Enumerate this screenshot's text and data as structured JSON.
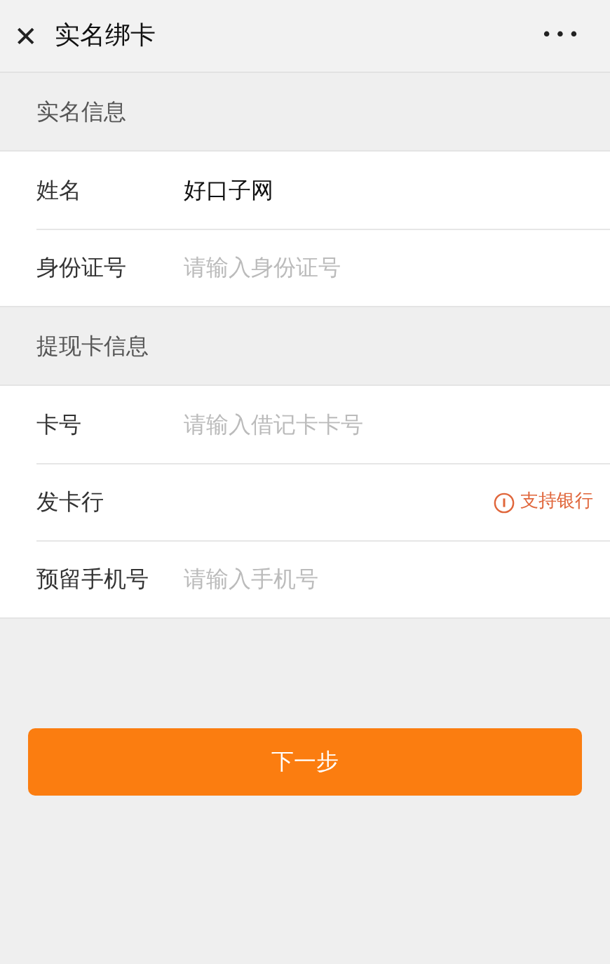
{
  "header": {
    "close": "✕",
    "title": "实名绑卡",
    "more": "•••"
  },
  "sections": [
    {
      "title": "实名信息",
      "rows": [
        {
          "kind": "input",
          "label": "姓名",
          "value": "好口子网"
        },
        {
          "kind": "input",
          "label": "身份证号",
          "placeholder": "请输入身份证号"
        }
      ]
    },
    {
      "title": "提现卡信息",
      "rows": [
        {
          "kind": "input",
          "label": "卡号",
          "placeholder": "请输入借记卡卡号"
        },
        {
          "kind": "link",
          "label": "发卡行",
          "action": "支持银行"
        },
        {
          "kind": "input",
          "label": "预留手机号",
          "placeholder": "请输入手机号"
        }
      ]
    }
  ],
  "button": "下一步"
}
